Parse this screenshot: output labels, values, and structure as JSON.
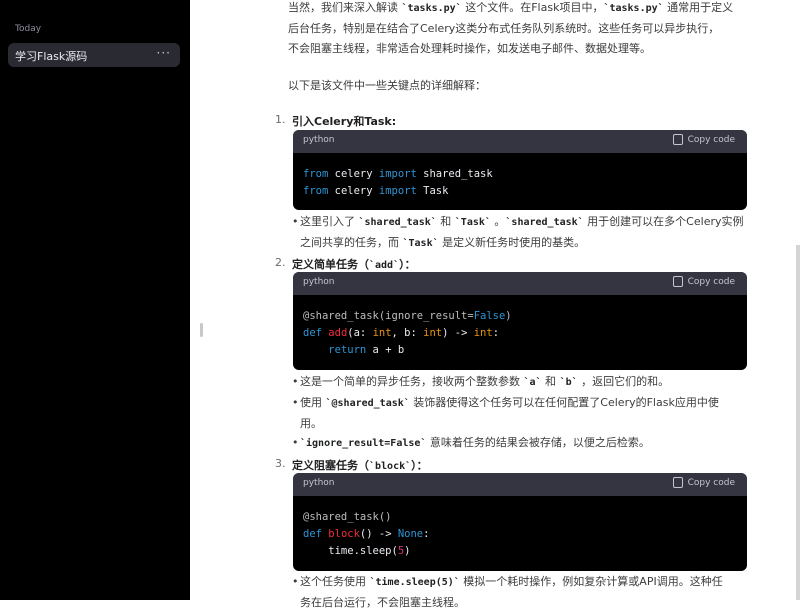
{
  "sidebar": {
    "section_label": "Today",
    "chat_title": "学习Flask源码",
    "more": "···"
  },
  "intro": {
    "l1a": "当然，我们来深入解读 ",
    "l1code": "`tasks.py`",
    "l1b": " 这个文件。在Flask项目中，",
    "l1code2": "`tasks.py`",
    "l1c": " 通常用于定义",
    "l2": "后台任务，特别是在结合了Celery这类分布式任务队列系统时。这些任务可以异步执行，",
    "l3": "不会阻塞主线程，非常适合处理耗时操作，如发送电子邮件、数据处理等。"
  },
  "lead": "以下是该文件中一些关键点的详细解释：",
  "sections": [
    {
      "num": "1.",
      "heading": "引入Celery和Task:",
      "code": {
        "lang": "python",
        "copy": "Copy code",
        "l1": [
          "from",
          " celery ",
          "import",
          " shared_task"
        ],
        "l2": [
          "from",
          " celery ",
          "import",
          " Task"
        ]
      },
      "bullets": [
        {
          "a": "这里引入了 ",
          "c1": "`shared_task`",
          "b": " 和 ",
          "c2": "`Task`",
          "c": " 。",
          "c3": "`shared_task`",
          "d": " 用于创建可以在多个Celery实例",
          "e": "之间共享的任务，而 ",
          "c4": "`Task`",
          "f": " 是定义新任务时使用的基类。"
        }
      ]
    },
    {
      "num": "2.",
      "heading_a": "定义简单任务（",
      "heading_code": "`add`",
      "heading_b": "）：",
      "code": {
        "lang": "python",
        "copy": "Copy code",
        "l1": [
          "@shared_task(ignore_result=",
          "False",
          ")"
        ],
        "l2": [
          "def",
          " ",
          "add",
          "(a: ",
          "int",
          ", b: ",
          "int",
          ") -> ",
          "int",
          ":"
        ],
        "l3": [
          "    ",
          "return",
          " a + b"
        ]
      },
      "bullets": [
        {
          "a": "这是一个简单的异步任务，接收两个整数参数 ",
          "c1": "`a`",
          "b": " 和 ",
          "c2": "`b`",
          "c": " ，返回它们的和。"
        },
        {
          "a": "使用 ",
          "c1": "`@shared_task`",
          "b": " 装饰器使得这个任务可以在任何配置了Celery的Flask应用中使",
          "c": "用。"
        },
        {
          "c1": "`ignore_result=False`",
          "a": " 意味着任务的结果会被存储，以便之后检索。"
        }
      ]
    },
    {
      "num": "3.",
      "heading_a": "定义阻塞任务（",
      "heading_code": "`block`",
      "heading_b": "）：",
      "code": {
        "lang": "python",
        "copy": "Copy code",
        "l1": [
          "@shared_task()"
        ],
        "l2": [
          "def",
          " ",
          "block",
          "() -> ",
          "None",
          ":"
        ],
        "l3": [
          "    time.sleep(",
          "5",
          ")"
        ]
      },
      "bullets": [
        {
          "a": "这个任务使用 ",
          "c1": "`time.sleep(5)`",
          "b": " 模拟一个耗时操作，例如复杂计算或API调用。这种任",
          "c": "务在后台运行，不会阻塞主线程。"
        }
      ]
    }
  ]
}
